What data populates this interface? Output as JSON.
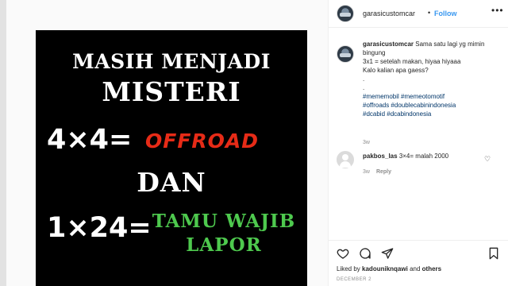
{
  "post": {
    "image_lines": {
      "line1": "MASIH MENJADI",
      "line2": "MISTERI",
      "eq1": "4×4=",
      "offroad": "OFFROAD",
      "dan": "DAN",
      "eq2": "1×24=",
      "tamu1": "TAMU WAJIB",
      "tamu2": "LAPOR"
    }
  },
  "header": {
    "username": "garasicustomcar",
    "separator": "•",
    "follow_label": "Follow",
    "more_icon": "more-dots-icon"
  },
  "caption": {
    "username": "garasicustomcar",
    "text": "Sama satu lagi yg mimin bingung\n3x1 = setelah makan, hiyaa hiyaaa\nKalo kalian apa gaess?\n.\n.",
    "hashtags_line1": "#mememobil #memeotomotif",
    "hashtags_line2": "#offroads #doublecabinindonesia",
    "hashtags_line3": "#dcabid #dcabindonesia",
    "time": "3w"
  },
  "comment": {
    "username": "pakbos_las",
    "text": "3×4= malah 2000",
    "time": "3w",
    "reply_label": "Reply"
  },
  "actions": {
    "icons": [
      "heart-icon",
      "comment-icon",
      "share-icon",
      "bookmark-icon"
    ]
  },
  "likes": {
    "prefix": "Liked by",
    "user": "kadouniknqawi",
    "and": "and",
    "others": "others"
  },
  "date": "DECEMBER 2",
  "colors": {
    "follow_blue": "#3897f0",
    "hashtag_blue": "#003569",
    "offroad_red": "#e62b17",
    "tamu_green": "#4ec94e"
  }
}
